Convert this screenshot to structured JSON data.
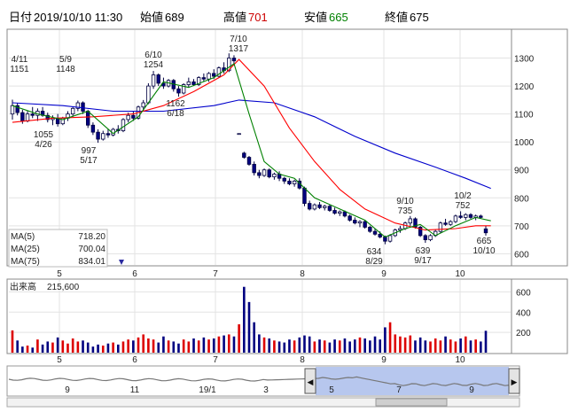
{
  "header": {
    "date_label": "日付",
    "datetime": "2019/10/10 11:30",
    "open_label": "始値",
    "open": "689",
    "high_label": "高値",
    "high": "701",
    "low_label": "安値",
    "low": "665",
    "close_label": "終値",
    "close": "675",
    "colors": {
      "high": "#cc0000",
      "low": "#008000",
      "default": "#000000"
    }
  },
  "legend": {
    "ma5": {
      "label": "MA(5)",
      "value": "718.20",
      "color": "#008000"
    },
    "ma25": {
      "label": "MA(25)",
      "value": "700.04",
      "color": "#ff0000"
    },
    "ma75": {
      "label": "MA(75)",
      "value": "834.01",
      "color": "#0000cc"
    }
  },
  "volume_title": "出来高",
  "volume_value": "215,600",
  "navigator": {
    "labels": [
      "9",
      "11",
      "19/1",
      "3",
      "5",
      "7",
      "9"
    ],
    "left_arrow": "◀",
    "right_arrow": "▶"
  },
  "chart_data": [
    {
      "type": "candlestick",
      "x_ticks": [
        "5",
        "6",
        "7",
        "8",
        "9",
        "10"
      ],
      "y_ticks": [
        600,
        700,
        800,
        900,
        1000,
        1100,
        1200,
        1300
      ],
      "ylim": [
        560,
        1400
      ],
      "grid": true,
      "candle_colors": {
        "up": "#ffffff",
        "down": "#000080"
      },
      "annotations": [
        {
          "date": "4/11",
          "price": "1151",
          "at": 1151
        },
        {
          "date": "5/9",
          "price": "1148",
          "at": 1148
        },
        {
          "price": "1055",
          "date": "4/26",
          "at": 1055
        },
        {
          "price": "997",
          "date": "5/17",
          "at": 997
        },
        {
          "date": "6/10",
          "price": "1254",
          "at": 1254
        },
        {
          "price": "1162",
          "date": "6/18",
          "at": 1162
        },
        {
          "date": "7/10",
          "price": "1317",
          "at": 1317
        },
        {
          "price": "634",
          "date": "8/29",
          "at": 634
        },
        {
          "date": "9/10",
          "price": "735",
          "at": 735
        },
        {
          "price": "639",
          "date": "9/17",
          "at": 639
        },
        {
          "date": "10/2",
          "price": "752",
          "at": 752
        },
        {
          "price": "665",
          "date": "10/10",
          "at": 665
        }
      ],
      "candles": [
        {
          "o": 1100,
          "h": 1151,
          "l": 1080,
          "c": 1130
        },
        {
          "o": 1130,
          "h": 1140,
          "l": 1095,
          "c": 1105
        },
        {
          "o": 1105,
          "h": 1115,
          "l": 1065,
          "c": 1075
        },
        {
          "o": 1075,
          "h": 1110,
          "l": 1070,
          "c": 1100
        },
        {
          "o": 1100,
          "h": 1125,
          "l": 1085,
          "c": 1095
        },
        {
          "o": 1095,
          "h": 1120,
          "l": 1075,
          "c": 1110
        },
        {
          "o": 1110,
          "h": 1125,
          "l": 1090,
          "c": 1095
        },
        {
          "o": 1095,
          "h": 1105,
          "l": 1070,
          "c": 1080
        },
        {
          "o": 1080,
          "h": 1095,
          "l": 1060,
          "c": 1085
        },
        {
          "o": 1085,
          "h": 1100,
          "l": 1055,
          "c": 1065
        },
        {
          "o": 1065,
          "h": 1090,
          "l": 1060,
          "c": 1085
        },
        {
          "o": 1085,
          "h": 1110,
          "l": 1075,
          "c": 1100
        },
        {
          "o": 1100,
          "h": 1125,
          "l": 1090,
          "c": 1120
        },
        {
          "o": 1120,
          "h": 1148,
          "l": 1110,
          "c": 1140
        },
        {
          "o": 1140,
          "h": 1145,
          "l": 1100,
          "c": 1110
        },
        {
          "o": 1110,
          "h": 1115,
          "l": 1050,
          "c": 1060
        },
        {
          "o": 1060,
          "h": 1070,
          "l": 1025,
          "c": 1035
        },
        {
          "o": 1035,
          "h": 1045,
          "l": 997,
          "c": 1010
        },
        {
          "o": 1010,
          "h": 1040,
          "l": 1005,
          "c": 1030
        },
        {
          "o": 1030,
          "h": 1045,
          "l": 1015,
          "c": 1025
        },
        {
          "o": 1025,
          "h": 1050,
          "l": 1020,
          "c": 1045
        },
        {
          "o": 1045,
          "h": 1060,
          "l": 1030,
          "c": 1040
        },
        {
          "o": 1040,
          "h": 1085,
          "l": 1035,
          "c": 1080
        },
        {
          "o": 1080,
          "h": 1105,
          "l": 1070,
          "c": 1095
        },
        {
          "o": 1095,
          "h": 1110,
          "l": 1075,
          "c": 1085
        },
        {
          "o": 1085,
          "h": 1130,
          "l": 1080,
          "c": 1125
        },
        {
          "o": 1125,
          "h": 1150,
          "l": 1110,
          "c": 1140
        },
        {
          "o": 1140,
          "h": 1210,
          "l": 1135,
          "c": 1200
        },
        {
          "o": 1200,
          "h": 1254,
          "l": 1190,
          "c": 1240
        },
        {
          "o": 1240,
          "h": 1245,
          "l": 1200,
          "c": 1210
        },
        {
          "o": 1210,
          "h": 1230,
          "l": 1190,
          "c": 1200
        },
        {
          "o": 1200,
          "h": 1225,
          "l": 1195,
          "c": 1220
        },
        {
          "o": 1220,
          "h": 1225,
          "l": 1180,
          "c": 1190
        },
        {
          "o": 1190,
          "h": 1200,
          "l": 1162,
          "c": 1175
        },
        {
          "o": 1175,
          "h": 1210,
          "l": 1170,
          "c": 1205
        },
        {
          "o": 1205,
          "h": 1230,
          "l": 1195,
          "c": 1215
        },
        {
          "o": 1215,
          "h": 1225,
          "l": 1200,
          "c": 1205
        },
        {
          "o": 1205,
          "h": 1235,
          "l": 1200,
          "c": 1230
        },
        {
          "o": 1230,
          "h": 1245,
          "l": 1215,
          "c": 1225
        },
        {
          "o": 1225,
          "h": 1250,
          "l": 1215,
          "c": 1245
        },
        {
          "o": 1245,
          "h": 1260,
          "l": 1225,
          "c": 1235
        },
        {
          "o": 1235,
          "h": 1270,
          "l": 1230,
          "c": 1265
        },
        {
          "o": 1265,
          "h": 1285,
          "l": 1245,
          "c": 1255
        },
        {
          "o": 1255,
          "h": 1317,
          "l": 1250,
          "c": 1300
        },
        {
          "o": 1300,
          "h": 1310,
          "l": 1280,
          "c": 1290
        },
        {
          "o": 1030,
          "h": 1030,
          "l": 1030,
          "c": 1030
        },
        {
          "o": 960,
          "h": 965,
          "l": 940,
          "c": 945
        },
        {
          "o": 945,
          "h": 950,
          "l": 915,
          "c": 920
        },
        {
          "o": 920,
          "h": 930,
          "l": 880,
          "c": 890
        },
        {
          "o": 890,
          "h": 900,
          "l": 870,
          "c": 880
        },
        {
          "o": 880,
          "h": 905,
          "l": 875,
          "c": 900
        },
        {
          "o": 900,
          "h": 905,
          "l": 870,
          "c": 875
        },
        {
          "o": 875,
          "h": 890,
          "l": 865,
          "c": 885
        },
        {
          "o": 885,
          "h": 895,
          "l": 860,
          "c": 870
        },
        {
          "o": 870,
          "h": 875,
          "l": 850,
          "c": 860
        },
        {
          "o": 860,
          "h": 870,
          "l": 845,
          "c": 850
        },
        {
          "o": 850,
          "h": 865,
          "l": 840,
          "c": 860
        },
        {
          "o": 860,
          "h": 870,
          "l": 830,
          "c": 835
        },
        {
          "o": 835,
          "h": 840,
          "l": 770,
          "c": 780
        },
        {
          "o": 780,
          "h": 790,
          "l": 755,
          "c": 760
        },
        {
          "o": 760,
          "h": 780,
          "l": 755,
          "c": 775
        },
        {
          "o": 775,
          "h": 785,
          "l": 760,
          "c": 765
        },
        {
          "o": 765,
          "h": 775,
          "l": 755,
          "c": 770
        },
        {
          "o": 770,
          "h": 775,
          "l": 750,
          "c": 755
        },
        {
          "o": 755,
          "h": 765,
          "l": 740,
          "c": 745
        },
        {
          "o": 745,
          "h": 755,
          "l": 735,
          "c": 750
        },
        {
          "o": 750,
          "h": 755,
          "l": 730,
          "c": 735
        },
        {
          "o": 735,
          "h": 740,
          "l": 715,
          "c": 720
        },
        {
          "o": 720,
          "h": 730,
          "l": 705,
          "c": 710
        },
        {
          "o": 710,
          "h": 720,
          "l": 695,
          "c": 715
        },
        {
          "o": 715,
          "h": 720,
          "l": 690,
          "c": 695
        },
        {
          "o": 695,
          "h": 700,
          "l": 675,
          "c": 680
        },
        {
          "o": 680,
          "h": 690,
          "l": 665,
          "c": 670
        },
        {
          "o": 670,
          "h": 680,
          "l": 655,
          "c": 660
        },
        {
          "o": 660,
          "h": 665,
          "l": 634,
          "c": 645
        },
        {
          "o": 645,
          "h": 670,
          "l": 640,
          "c": 665
        },
        {
          "o": 665,
          "h": 690,
          "l": 660,
          "c": 685
        },
        {
          "o": 685,
          "h": 700,
          "l": 675,
          "c": 690
        },
        {
          "o": 690,
          "h": 715,
          "l": 685,
          "c": 710
        },
        {
          "o": 710,
          "h": 735,
          "l": 700,
          "c": 725
        },
        {
          "o": 725,
          "h": 730,
          "l": 690,
          "c": 695
        },
        {
          "o": 695,
          "h": 700,
          "l": 660,
          "c": 665
        },
        {
          "o": 665,
          "h": 670,
          "l": 639,
          "c": 650
        },
        {
          "o": 650,
          "h": 670,
          "l": 645,
          "c": 665
        },
        {
          "o": 665,
          "h": 685,
          "l": 660,
          "c": 680
        },
        {
          "o": 680,
          "h": 715,
          "l": 675,
          "c": 710
        },
        {
          "o": 710,
          "h": 725,
          "l": 700,
          "c": 705
        },
        {
          "o": 705,
          "h": 720,
          "l": 700,
          "c": 715
        },
        {
          "o": 715,
          "h": 740,
          "l": 710,
          "c": 735
        },
        {
          "o": 735,
          "h": 752,
          "l": 725,
          "c": 730
        },
        {
          "o": 730,
          "h": 745,
          "l": 720,
          "c": 740
        },
        {
          "o": 740,
          "h": 745,
          "l": 725,
          "c": 730
        },
        {
          "o": 730,
          "h": 740,
          "l": 720,
          "c": 735
        },
        {
          "o": 735,
          "h": 740,
          "l": 725,
          "c": 730
        },
        {
          "o": 689,
          "h": 701,
          "l": 665,
          "c": 675
        }
      ],
      "ma5": [
        [
          0,
          1130
        ],
        [
          5,
          1100
        ],
        [
          10,
          1080
        ],
        [
          15,
          1110
        ],
        [
          20,
          1030
        ],
        [
          25,
          1090
        ],
        [
          30,
          1215
        ],
        [
          35,
          1195
        ],
        [
          40,
          1230
        ],
        [
          44,
          1280
        ],
        [
          47,
          1100
        ],
        [
          50,
          930
        ],
        [
          53,
          885
        ],
        [
          56,
          870
        ],
        [
          60,
          800
        ],
        [
          65,
          760
        ],
        [
          70,
          720
        ],
        [
          74,
          660
        ],
        [
          78,
          690
        ],
        [
          81,
          705
        ],
        [
          84,
          665
        ],
        [
          88,
          700
        ],
        [
          92,
          730
        ],
        [
          95,
          718
        ]
      ],
      "ma25": [
        [
          0,
          1070
        ],
        [
          8,
          1085
        ],
        [
          16,
          1090
        ],
        [
          24,
          1100
        ],
        [
          30,
          1130
        ],
        [
          36,
          1180
        ],
        [
          42,
          1240
        ],
        [
          45,
          1295
        ],
        [
          50,
          1200
        ],
        [
          55,
          1050
        ],
        [
          60,
          930
        ],
        [
          65,
          830
        ],
        [
          70,
          760
        ],
        [
          76,
          710
        ],
        [
          82,
          685
        ],
        [
          88,
          690
        ],
        [
          92,
          700
        ],
        [
          95,
          700
        ]
      ],
      "ma75": [
        [
          0,
          1140
        ],
        [
          10,
          1130
        ],
        [
          20,
          1110
        ],
        [
          30,
          1110
        ],
        [
          40,
          1130
        ],
        [
          45,
          1150
        ],
        [
          52,
          1140
        ],
        [
          60,
          1090
        ],
        [
          68,
          1020
        ],
        [
          76,
          960
        ],
        [
          84,
          910
        ],
        [
          90,
          870
        ],
        [
          95,
          834
        ]
      ]
    },
    {
      "type": "bar",
      "title": "出来高",
      "y_ticks": [
        200,
        400,
        600
      ],
      "ylim": [
        0,
        700
      ],
      "x_ticks": [
        "5",
        "6",
        "7",
        "8",
        "9",
        "10"
      ],
      "values": [
        220,
        120,
        60,
        70,
        50,
        130,
        80,
        110,
        100,
        150,
        120,
        90,
        140,
        110,
        120,
        100,
        60,
        80,
        70,
        90,
        100,
        80,
        110,
        130,
        120,
        150,
        180,
        140,
        130,
        100,
        160,
        120,
        110,
        90,
        130,
        110,
        140,
        120,
        150,
        130,
        140,
        160,
        170,
        180,
        160,
        280,
        650,
        500,
        300,
        180,
        150,
        140,
        120,
        110,
        100,
        130,
        120,
        150,
        170,
        160,
        110,
        130,
        120,
        100,
        130,
        120,
        140,
        110,
        130,
        150,
        140,
        120,
        160,
        130,
        250,
        300,
        180,
        160,
        150,
        170,
        120,
        150,
        120,
        110,
        140,
        120,
        160,
        130,
        110,
        140,
        160,
        120,
        130,
        110,
        216
      ]
    }
  ]
}
